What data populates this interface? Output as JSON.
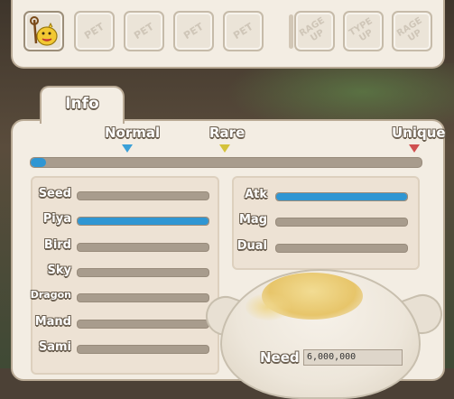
{
  "slots": [
    {
      "label": "",
      "icon": "pet-character-icon",
      "active": true
    },
    {
      "label": "PET",
      "active": false
    },
    {
      "label": "PET",
      "active": false
    },
    {
      "label": "PET",
      "active": false
    },
    {
      "label": "PET",
      "active": false
    },
    {
      "label": "RAGE UP",
      "active": false
    },
    {
      "label": "TYPE UP",
      "active": false
    },
    {
      "label": "RAGE UP",
      "active": false
    }
  ],
  "tab": {
    "label": "Info"
  },
  "rarity": {
    "labels": [
      "Normal",
      "Rare",
      "Unique"
    ],
    "marker_colors": [
      "#3aa0d8",
      "#d4c23a",
      "#d05050"
    ],
    "progress": 0.04
  },
  "stats_left": [
    {
      "name": "Seed",
      "value": 0
    },
    {
      "name": "Piya",
      "value": 1
    },
    {
      "name": "Bird",
      "value": 0
    },
    {
      "name": "Sky",
      "value": 0
    },
    {
      "name": "Dragon",
      "value": 0
    },
    {
      "name": "Mand",
      "value": 0
    },
    {
      "name": "Sami",
      "value": 0
    }
  ],
  "stats_right": [
    {
      "name": "Atk",
      "value": 1
    },
    {
      "name": "Mag",
      "value": 0
    },
    {
      "name": "Dual",
      "value": 0
    }
  ],
  "need": {
    "label": "Need",
    "value": "6,000,000"
  },
  "colors": {
    "accent": "#2f96d3",
    "panel": "#f3ede3",
    "border": "#b9aa95"
  }
}
